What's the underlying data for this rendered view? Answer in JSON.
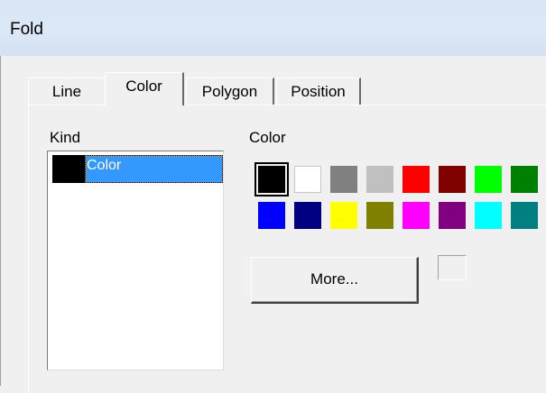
{
  "window": {
    "title": "Fold"
  },
  "tabs": [
    {
      "label": "Line",
      "selected": false
    },
    {
      "label": "Color",
      "selected": true
    },
    {
      "label": "Polygon",
      "selected": false
    },
    {
      "label": "Position",
      "selected": false
    }
  ],
  "kind": {
    "label": "Kind",
    "items": [
      {
        "label": "Color",
        "swatch_color": "#000000",
        "selected": true
      }
    ]
  },
  "color": {
    "label": "Color",
    "palette": [
      "#000000",
      "#ffffff",
      "#808080",
      "#c0c0c0",
      "#ff0000",
      "#800000",
      "#00ff00",
      "#008000",
      "#0000ff",
      "#000080",
      "#ffff00",
      "#808000",
      "#ff00ff",
      "#800080",
      "#00ffff",
      "#008080"
    ],
    "selected_color": "#000000",
    "more_label": "More..."
  }
}
